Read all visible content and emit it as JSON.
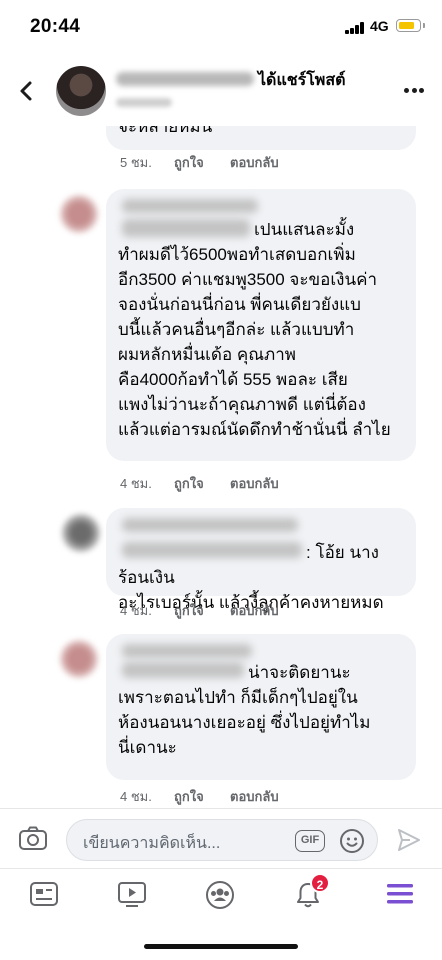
{
  "status_bar": {
    "time": "20:44",
    "network": "4G"
  },
  "header": {
    "action_text": "ได้แชร์โพสต์"
  },
  "comments": [
    {
      "text": "จะหลายหมื่น",
      "time": "5 ชม.",
      "like": "ถูกใจ",
      "reply": "ตอบกลับ"
    },
    {
      "text": "เปนแสนละมั้ง\nทำผมดีไว้6500พอทำเสดบอกเพิ่ม\nอีก3500 ค่าแชมพู3500 จะขอเงินค่า\nจองนั่นก่อนนี่ก่อน พี่คนเดียวยังแบ\nบนี้แล้วคนอื่นๆอีกล่ะ แล้วแบบทำ\nผมหลักหมื่นเด้อ คุณภาพ\nคือ4000ก้อทำได้ 555 พอละ เสีย\nแพงไม่ว่านะถ้าคุณภาพดี แต่นี่ต้อง\nแล้วแต่อารมณ์นัดดึกทำช้านั่นนี่ ลำไย",
      "time": "4 ชม.",
      "like": "ถูกใจ",
      "reply": "ตอบกลับ"
    },
    {
      "text": ": โอ้ย นางร้อนเงิน\nอะไรเบอร์นั้น แล้วงี้ลูกค้าคงหายหมด",
      "time": "4 ชม.",
      "like": "ถูกใจ",
      "reply": "ตอบกลับ"
    },
    {
      "text": "น่าจะติดยานะ\nเพราะตอนไปทำ ก็มีเด็กๆไปอยู่ใน\nห้องนอนนางเยอะอยู่ ซึ่งไปอยู่ทำไม\nนี่เดานะ",
      "time": "4 ชม.",
      "like": "ถูกใจ",
      "reply": "ตอบกลับ"
    }
  ],
  "composer": {
    "placeholder": "เขียนความคิดเห็น...",
    "gif_label": "GIF"
  },
  "tabbar": {
    "notification_count": "2"
  },
  "colors": {
    "accent": "#7b4fd1",
    "badge": "#e41e3f",
    "bubble": "#f0f2f5",
    "battery": "#f5c400"
  },
  "icons": [
    "back-icon",
    "more-icon",
    "camera-icon",
    "gif-icon",
    "sticker-icon",
    "send-icon",
    "news-feed-icon",
    "watch-icon",
    "groups-icon",
    "bell-icon",
    "menu-icon"
  ]
}
